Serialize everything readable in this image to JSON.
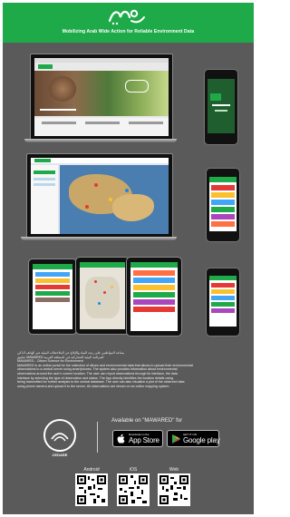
{
  "header": {
    "subtitle": "Mobilizing Arab Wide Action for Reliable Environment Data",
    "color": "#1faa4a"
  },
  "text": {
    "lines": [
      "يساعد المواطنين على رصد البيئة والإبلاغ عن الملاحظات البيئية عبر الهاتف الذكي",
      "تطبيق MAWARED للمراقبة البيئية التشاركية في المنطقة العربية",
      "MAWARED - Citizen Science for Environment",
      "MAWARED is an online portal for the collection of citizen and environmental data that allows to upload their environmental",
      "observations to a central server using smartphones. The system also provides information about environmental",
      "observations around the user's current location. The user can report observations through its interface, the data",
      "interface by selecting the type of observation and status. The App directly identifies the location details using",
      "being transmitted for further analysis to the central database. The user can also visualize a plot of the observed data",
      "using phone camera and upload it to the server. All observations are shown on an online mapping system."
    ]
  },
  "organization": {
    "name": "CEDARE"
  },
  "download": {
    "available_on": "Available on \"MAWARED\" for",
    "app_store_small": "Download on the",
    "app_store_big": "App Store",
    "google_play_small": "GET IT ON",
    "google_play_big": "Google play"
  },
  "qr_codes": {
    "labels": [
      "Android",
      "iOS",
      "Web"
    ]
  },
  "icons": {
    "apple": "apple-icon",
    "play": "google-play-icon"
  }
}
